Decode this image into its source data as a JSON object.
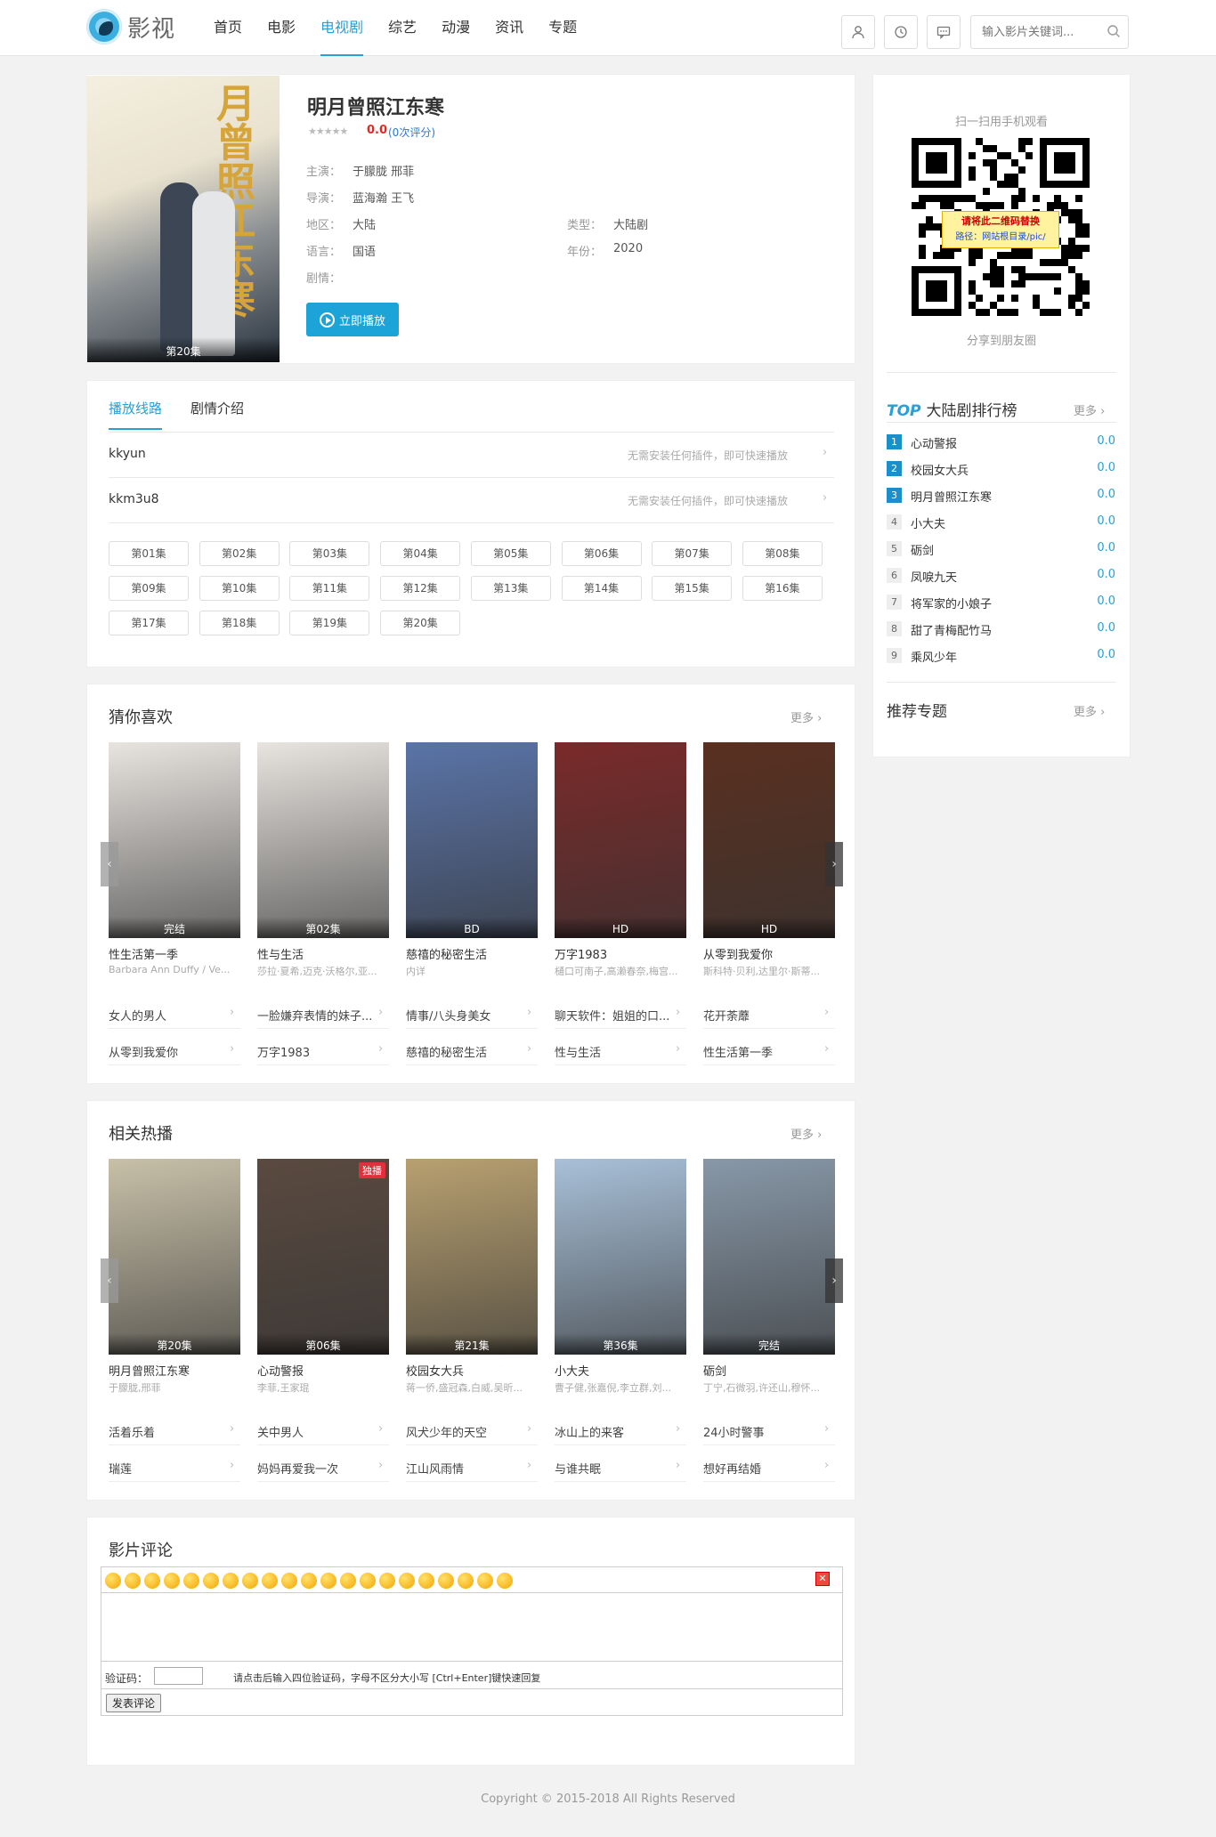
{
  "site": {
    "name": "影视",
    "nav": [
      {
        "label": "首页"
      },
      {
        "label": "电影"
      },
      {
        "label": "电视剧",
        "active": true
      },
      {
        "label": "综艺"
      },
      {
        "label": "动漫"
      },
      {
        "label": "资讯"
      },
      {
        "label": "专题"
      }
    ],
    "search_placeholder": "输入影片关键词...",
    "icons": [
      "user-icon",
      "history-icon",
      "message-icon",
      "search-icon"
    ]
  },
  "detail": {
    "title": "明月曾照江东寒",
    "poster_title": "月曾照江东寒",
    "poster_label": "第20集",
    "score": "0.0",
    "votes": "(0次评分)",
    "stars": "★★★★★",
    "actor_label": "主演：",
    "actors": "于朦胧  邢菲",
    "director_label": "导演：",
    "directors": "蓝海瀚  王飞",
    "area_label": "地区：",
    "area": "大陆",
    "type_label": "类型：",
    "type": "大陆剧",
    "lang_label": "语言：",
    "lang": "国语",
    "year_label": "年份：",
    "year": "2020",
    "plot_label": "剧情：",
    "plot": "",
    "play": "立即播放"
  },
  "playlist": {
    "tabs": [
      "播放线路",
      "剧情介绍"
    ],
    "routes": [
      {
        "name": "kkyun",
        "note": "无需安装任何插件，即可快速播放"
      },
      {
        "name": "kkm3u8",
        "note": "无需安装任何插件，即可快速播放"
      }
    ],
    "episodes": [
      "第01集",
      "第02集",
      "第03集",
      "第04集",
      "第05集",
      "第06集",
      "第07集",
      "第08集",
      "第09集",
      "第10集",
      "第11集",
      "第12集",
      "第13集",
      "第14集",
      "第15集",
      "第16集",
      "第17集",
      "第18集",
      "第19集",
      "第20集"
    ]
  },
  "guess": {
    "title": "猜你喜欢",
    "more": "更多",
    "items": [
      {
        "title": "性生活第一季",
        "actor": "Barbara Ann Duffy / Ve...",
        "tag": "完结",
        "color": "#e8e4e0"
      },
      {
        "title": "性与生活",
        "actor": "莎拉·夏希,迈克·沃格尔,亚...",
        "tag": "第02集",
        "color": "#e8e4e0"
      },
      {
        "title": "慈禧的秘密生活",
        "actor": "内详",
        "tag": "BD",
        "color": "#5a74a8"
      },
      {
        "title": "万字1983",
        "actor": "樋口可南子,高濑春奈,梅宫...",
        "tag": "HD",
        "color": "#7a2a2a"
      },
      {
        "title": "从零到我爱你",
        "actor": "斯科特·贝利,达里尔·斯蒂...",
        "tag": "HD",
        "color": "#5a3020"
      }
    ],
    "links": [
      [
        "女人的男人",
        "一脸嫌弃表情的妹子...",
        "情事/八头身美女",
        "聊天软件：姐姐的口...",
        "花开荼蘼"
      ],
      [
        "从零到我爱你",
        "万字1983",
        "慈禧的秘密生活",
        "性与生活",
        "性生活第一季"
      ]
    ]
  },
  "hot": {
    "title": "相关热播",
    "more": "更多",
    "items": [
      {
        "title": "明月曾照江东寒",
        "actor": "于朦胧,邢菲",
        "tag": "第20集",
        "color": "#c8c0a8",
        "badge": ""
      },
      {
        "title": "心动警报",
        "actor": "李菲,王家琨",
        "tag": "第06集",
        "color": "#5a4a40",
        "badge": "独播"
      },
      {
        "title": "校园女大兵",
        "actor": "蒋一侨,盛冠森,白威,吴昕...",
        "tag": "第21集",
        "color": "#b8a070",
        "badge": ""
      },
      {
        "title": "小大夫",
        "actor": "曹子健,张嘉倪,李立群,刘...",
        "tag": "第36集",
        "color": "#a8c0d8",
        "badge": ""
      },
      {
        "title": "砺剑",
        "actor": "丁宁,石微羽,许还山,穆怀...",
        "tag": "完结",
        "color": "#8898a8",
        "badge": ""
      }
    ],
    "links": [
      [
        "活着乐着",
        "关中男人",
        "风犬少年的天空",
        "冰山上的来客",
        "24小时警事"
      ],
      [
        "瑞莲",
        "妈妈再爱我一次",
        "江山风雨情",
        "与谁共眠",
        "想好再结婚"
      ]
    ]
  },
  "sidebar": {
    "qr_title": "扫一扫用手机观看",
    "qr_note1": "请将此二维码替换",
    "qr_note2": "路径：网站根目录/pic/",
    "qr_share": "分享到朋友圈",
    "rank_top": "TOP",
    "rank_title": "大陆剧排行榜",
    "rank_more": "更多",
    "ranks": [
      {
        "n": "1",
        "name": "心动警报",
        "s": "0.0"
      },
      {
        "n": "2",
        "name": "校园女大兵",
        "s": "0.0"
      },
      {
        "n": "3",
        "name": "明月曾照江东寒",
        "s": "0.0"
      },
      {
        "n": "4",
        "name": "小大夫",
        "s": "0.0"
      },
      {
        "n": "5",
        "name": "砺剑",
        "s": "0.0"
      },
      {
        "n": "6",
        "name": "凤唳九天",
        "s": "0.0"
      },
      {
        "n": "7",
        "name": "将军家的小娘子",
        "s": "0.0"
      },
      {
        "n": "8",
        "name": "甜了青梅配竹马",
        "s": "0.0"
      },
      {
        "n": "9",
        "name": "乘风少年",
        "s": "0.0"
      }
    ],
    "topic_title": "推荐专题",
    "topic_more": "更多"
  },
  "comment": {
    "title": "影片评论",
    "captcha_label": "验证码：",
    "hint": "请点击后输入四位验证码，字母不区分大小写 [Ctrl+Enter]键快速回复",
    "submit": "发表评论"
  },
  "footer": "Copyright © 2015-2018 All Rights Reserved"
}
